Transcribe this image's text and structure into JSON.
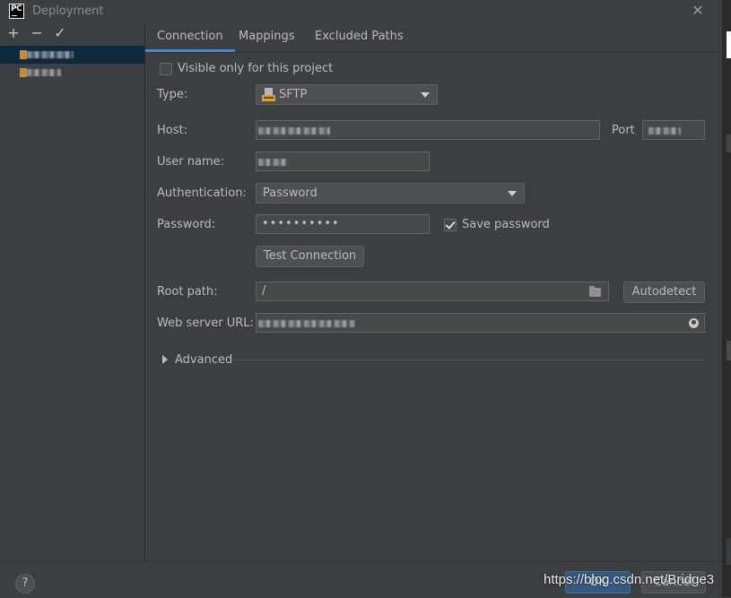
{
  "window": {
    "title": "Deployment",
    "close_glyph": "✕"
  },
  "toolbar": {
    "add": "+",
    "remove": "−",
    "apply": "✓"
  },
  "tabs": [
    {
      "label": "Connection",
      "active": true
    },
    {
      "label": "Mappings",
      "active": false
    },
    {
      "label": "Excluded Paths",
      "active": false
    }
  ],
  "form": {
    "visible_only_label": "Visible only for this project",
    "type_label": "Type:",
    "type_value": "SFTP",
    "host_label": "Host:",
    "port_label": "Port",
    "username_label": "User name:",
    "auth_label": "Authentication:",
    "auth_value": "Password",
    "password_label": "Password:",
    "password_value": "••••••••••",
    "save_password_label": "Save password",
    "test_connection_label": "Test Connection",
    "root_path_label": "Root path:",
    "root_path_value": "/",
    "autodetect_label": "Autodetect",
    "web_url_label": "Web server URL:",
    "advanced_label": "Advanced"
  },
  "footer": {
    "help": "?",
    "ok": "OK",
    "cancel": "Cancel"
  },
  "watermark": "https://blog.csdn.net/Bridge3",
  "colors": {
    "accent": "#4a88c7",
    "ok_button": "#365880",
    "selected_row": "#0d293e"
  }
}
